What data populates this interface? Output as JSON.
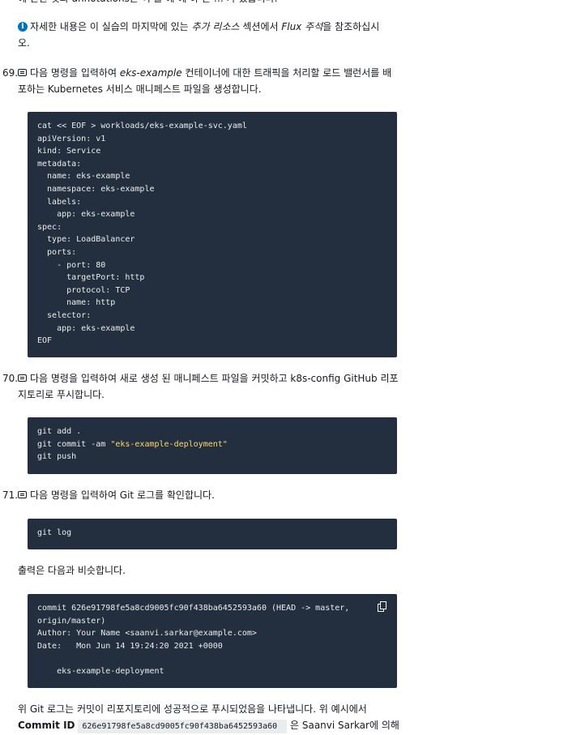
{
  "top_partial": "에 관한 것과 annotations는 어 를 에 에 하 는 … 가 있습니다.",
  "info_note": {
    "text_before": "자세한 내용은 이 실습의 마지막에 있는 ",
    "em1": "추가 리소스",
    "text_mid": " 섹션에서 ",
    "em2": "Flux 주석",
    "text_after": "을 참조하십시",
    "line2": "오."
  },
  "step69": {
    "num": "69.",
    "line1_before": "다음 명령을 입력하여 ",
    "line1_em": "eks-example",
    "line1_after": " 컨테이너에 대한 트래픽을 처리할 로드 밸런서를 배",
    "line2": "포하는 Kubernetes 서비스 매니페스트 파일을 생성합니다.",
    "code": "cat << EOF > workloads/eks-example-svc.yaml\napiVersion: v1\nkind: Service\nmetadata:\n  name: eks-example\n  namespace: eks-example\n  labels:\n    app: eks-example\nspec:\n  type: LoadBalancer\n  ports:\n    - port: 80\n      targetPort: http\n      protocol: TCP\n      name: http\n  selector:\n    app: eks-example\nEOF"
  },
  "step70": {
    "num": "70.",
    "line1": "다음 명령을 입력하여 새로 생성 된 매니페스트 파일을 커밋하고 k8s-config GitHub 리포",
    "line2": "지토리로 푸시합니다.",
    "code_line1": "git add .",
    "code_line2_cmd": "git commit -am ",
    "code_line2_str": "\"eks-example-deployment\"",
    "code_line3": "git push"
  },
  "step71": {
    "num": "71.",
    "line1": "다음 명령을 입력하여 Git 로그를 확인합니다.",
    "code": "git log"
  },
  "output_label": "출력은 다음과 비슷합니다.",
  "output_code": "commit 626e91798fe5a8cd9005fc90f438ba6452593a60 (HEAD -> master,\norigin/master)\nAuthor: Your Name <saanvi.sarkar@example.com>\nDate:   Mon Jun 14 19:24:20 2021 +0000\n\n    eks-example-deployment",
  "bottom": {
    "line1": "위 Git 로그는 커밋이 리포지토리에 성공적으로 푸시되었음을 나타냅니다. 위 예시에서",
    "commit_label": "Commit ID",
    "commit_value": "626e91798fe5a8cd9005fc90f438ba6452593a60",
    "line2_after": "은 Saanvi Sarkar에 의해"
  }
}
